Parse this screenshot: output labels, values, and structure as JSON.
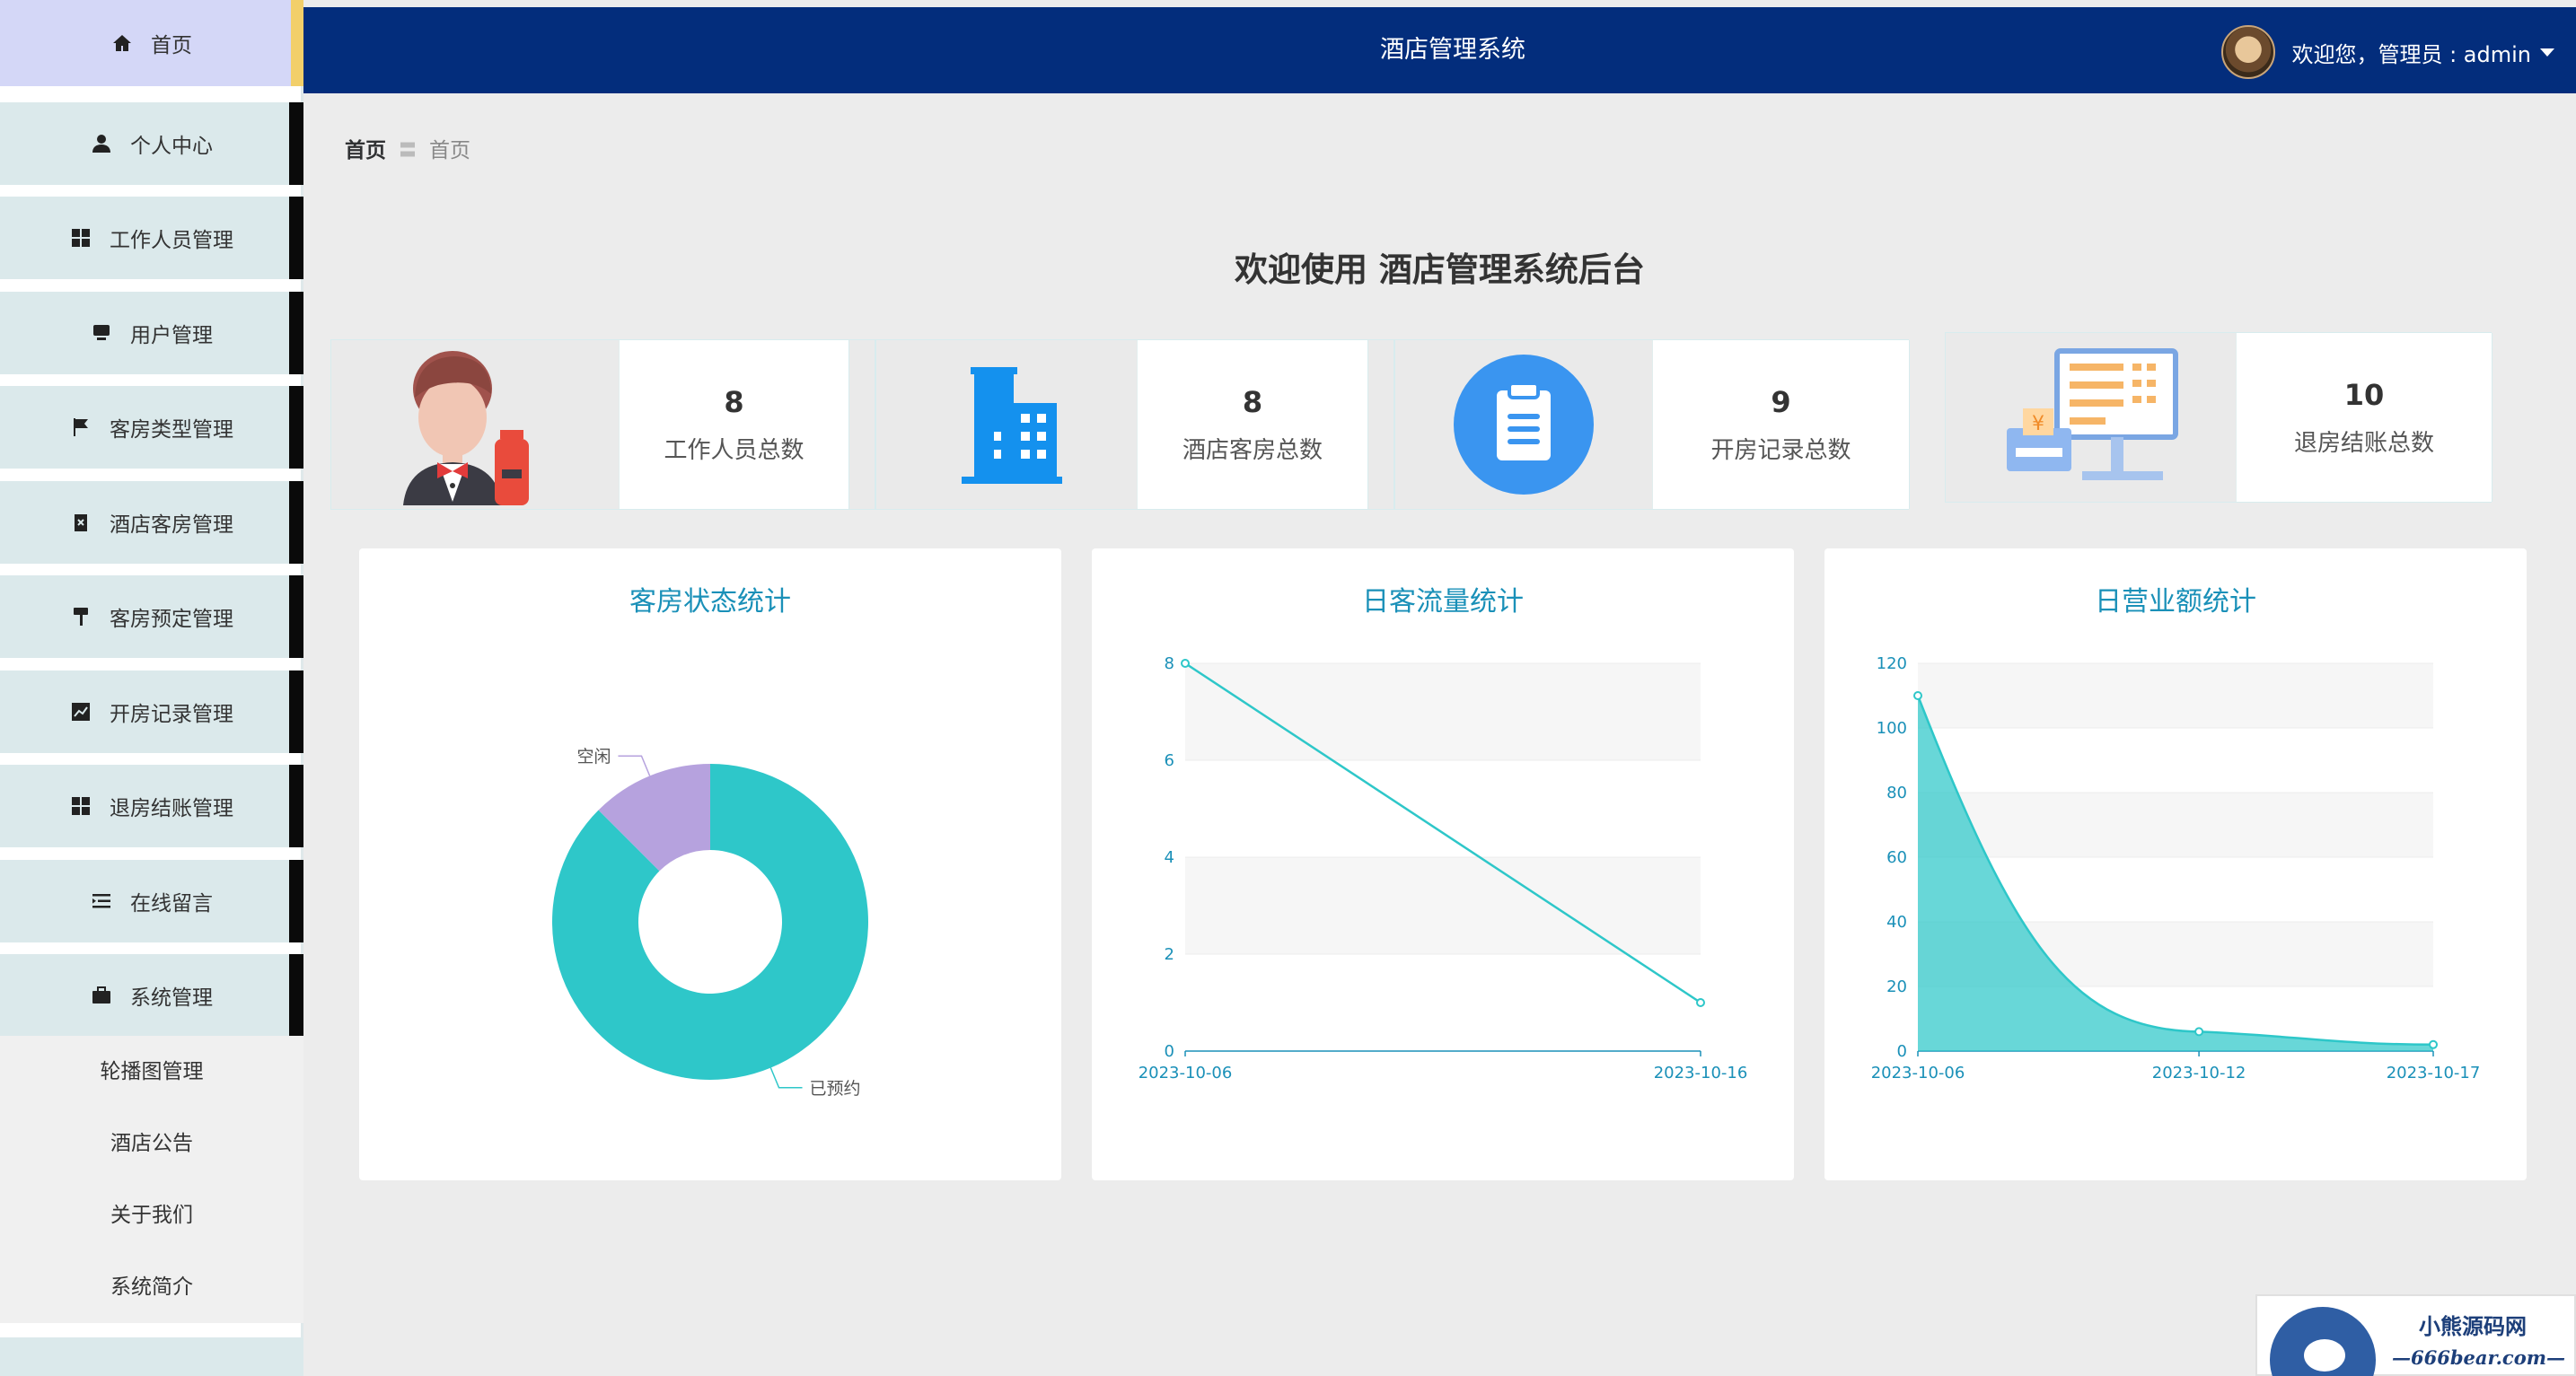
{
  "app": {
    "title": "酒店管理系统"
  },
  "user": {
    "greeting": "欢迎您，",
    "role_label": "管理员 : admin"
  },
  "sidebar": {
    "items": [
      {
        "label": "首页",
        "icon": "home-icon"
      },
      {
        "label": "个人中心",
        "icon": "user-icon"
      },
      {
        "label": "工作人员管理",
        "icon": "grid-icon"
      },
      {
        "label": "用户管理",
        "icon": "monitor-icon"
      },
      {
        "label": "客房类型管理",
        "icon": "flag-icon"
      },
      {
        "label": "酒店客房管理",
        "icon": "clipboard-x-icon"
      },
      {
        "label": "客房预定管理",
        "icon": "paint-roller-icon"
      },
      {
        "label": "开房记录管理",
        "icon": "line-chart-icon"
      },
      {
        "label": "退房结账管理",
        "icon": "grid-icon"
      },
      {
        "label": "在线留言",
        "icon": "list-indent-icon"
      },
      {
        "label": "系统管理",
        "icon": "briefcase-icon"
      }
    ],
    "submenu": [
      "轮播图管理",
      "酒店公告",
      "关于我们",
      "系统简介"
    ]
  },
  "breadcrumb": {
    "home": "首页",
    "separator": "〓",
    "current": "首页"
  },
  "welcome": "欢迎使用 酒店管理系统后台",
  "stats": [
    {
      "value": "8",
      "label": "工作人员总数",
      "icon": "waiter-icon"
    },
    {
      "value": "8",
      "label": "酒店客房总数",
      "icon": "building-icon"
    },
    {
      "value": "9",
      "label": "开房记录总数",
      "icon": "clipboard-icon"
    },
    {
      "value": "10",
      "label": "退房结账总数",
      "icon": "cash-register-icon"
    }
  ],
  "colors": {
    "header": "#032d7c",
    "accent": "#2ec7c9",
    "secondary": "#b6a2de",
    "title": "#1a90b8"
  },
  "chart_data": [
    {
      "type": "pie",
      "title": "客房状态统计",
      "categories": [
        "已预约",
        "空闲"
      ],
      "values": [
        7,
        1
      ],
      "donut": true
    },
    {
      "type": "line",
      "title": "日客流量统计",
      "x": [
        "2023-10-06",
        "2023-10-16"
      ],
      "values": [
        8,
        1
      ],
      "ylim": [
        0,
        8
      ],
      "yticks": [
        0,
        2,
        4,
        6,
        8
      ],
      "grid": true
    },
    {
      "type": "area",
      "title": "日营业额统计",
      "x": [
        "2023-10-06",
        "2023-10-12",
        "2023-10-17"
      ],
      "values": [
        110,
        6,
        2
      ],
      "ylim": [
        0,
        120
      ],
      "yticks": [
        0,
        20,
        40,
        60,
        80,
        100,
        120
      ],
      "smooth": true,
      "grid": true
    }
  ],
  "watermark": {
    "name": "小熊源码网",
    "url": "—666bear.com—"
  }
}
